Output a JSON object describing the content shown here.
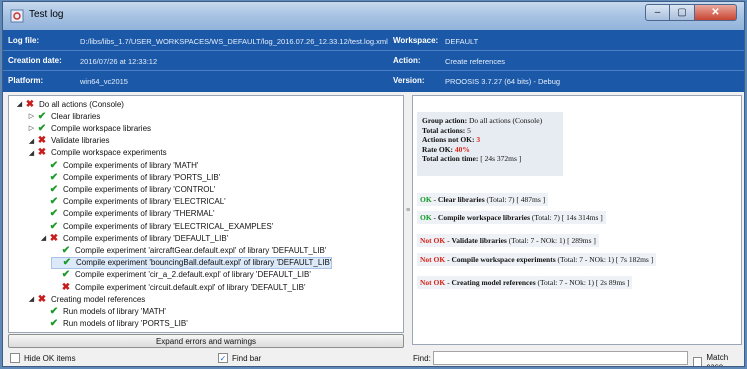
{
  "window": {
    "title": "Test log",
    "minimize": "–",
    "maximize": "▢",
    "close": "✕"
  },
  "header": {
    "log_file_label": "Log file:",
    "log_file_value": "D:/libs/libs_1.7/USER_WORKSPACES/WS_DEFAULT/log_2016.07.26_12.33.12/test.log.xml",
    "workspace_label": "Workspace:",
    "workspace_value": "DEFAULT",
    "creation_label": "Creation date:",
    "creation_value": "2016/07/26 at 12:33:12",
    "action_label": "Action:",
    "action_value": "Create references",
    "platform_label": "Platform:",
    "platform_value": "win64_vc2015",
    "version_label": "Version:",
    "version_value": "PROOSIS 3.7.27 (64 bits) - Debug"
  },
  "tree": [
    {
      "label": "Do all actions (Console)",
      "status": "fail",
      "expander": "expanded",
      "level": 0
    },
    {
      "label": "Clear libraries",
      "status": "ok",
      "expander": "collapsed",
      "level": 1
    },
    {
      "label": "Compile workspace libraries",
      "status": "ok",
      "expander": "collapsed",
      "level": 1
    },
    {
      "label": "Validate libraries",
      "status": "fail",
      "expander": "expanded",
      "level": 1
    },
    {
      "label": "Compile workspace experiments",
      "status": "fail",
      "expander": "expanded",
      "level": 1
    },
    {
      "label": "Compile experiments of library 'MATH'",
      "status": "ok",
      "expander": "none",
      "level": 2
    },
    {
      "label": "Compile experiments of library 'PORTS_LIB'",
      "status": "ok",
      "expander": "none",
      "level": 2
    },
    {
      "label": "Compile experiments of library 'CONTROL'",
      "status": "ok",
      "expander": "none",
      "level": 2
    },
    {
      "label": "Compile experiments of library 'ELECTRICAL'",
      "status": "ok",
      "expander": "none",
      "level": 2
    },
    {
      "label": "Compile experiments of library 'THERMAL'",
      "status": "ok",
      "expander": "none",
      "level": 2
    },
    {
      "label": "Compile experiments of library 'ELECTRICAL_EXAMPLES'",
      "status": "ok",
      "expander": "none",
      "level": 2
    },
    {
      "label": "Compile experiments of library 'DEFAULT_LIB'",
      "status": "fail",
      "expander": "expanded",
      "level": 2
    },
    {
      "label": "Compile experiment 'aircraftGear.default.expl' of library 'DEFAULT_LIB'",
      "status": "ok",
      "expander": "none",
      "level": 3
    },
    {
      "label": "Compile experiment 'bouncingBall.default.expl' of library 'DEFAULT_LIB'",
      "status": "ok",
      "expander": "none",
      "level": 3,
      "selected": true
    },
    {
      "label": "Compile experiment 'cir_a_2.default.expl' of library 'DEFAULT_LIB'",
      "status": "ok",
      "expander": "none",
      "level": 3
    },
    {
      "label": "Compile experiment 'circuit.default.expl' of library 'DEFAULT_LIB'",
      "status": "fail",
      "expander": "none",
      "level": 3
    },
    {
      "label": "Creating model references",
      "status": "fail",
      "expander": "expanded",
      "level": 1
    },
    {
      "label": "Run models of library 'MATH'",
      "status": "ok",
      "expander": "none",
      "level": 2
    },
    {
      "label": "Run models of library 'PORTS_LIB'",
      "status": "ok",
      "expander": "none",
      "level": 2
    }
  ],
  "summary": {
    "group_label": "Group action:",
    "group_value": "Do all actions (Console)",
    "total_label": "Total actions:",
    "total_value": "5",
    "notok_label": "Actions not OK:",
    "notok_value": "3",
    "rate_label": "Rate OK:",
    "rate_value": "40%",
    "time_label": "Total action time:",
    "time_value": "[ 24s 372ms ]"
  },
  "report": [
    {
      "status": "OK",
      "action": "Clear libraries",
      "detail": "(Total: 7) [ 487ms ]",
      "ok": true
    },
    {
      "status": "OK",
      "action": "Compile workspace libraries",
      "detail": "(Total: 7) [ 14s 314ms ]",
      "ok": true
    },
    {
      "status": "Not OK",
      "action": "Validate libraries",
      "detail": "(Total: 7 - NOk: 1) [ 289ms ]",
      "ok": false
    },
    {
      "status": "Not OK",
      "action": "Compile workspace experiments",
      "detail": "(Total: 7 - NOk: 1) [ 7s 182ms ]",
      "ok": false
    },
    {
      "status": "Not OK",
      "action": "Creating model references",
      "detail": "(Total: 7 - NOk: 1) [ 2s 89ms ]",
      "ok": false
    }
  ],
  "controls": {
    "expand_button": "Expand errors and warnings",
    "hide_ok": "Hide OK items",
    "find_bar": "Find bar",
    "find_label": "Find:",
    "find_value": "",
    "find_placeholder": "",
    "match_case": "Match case",
    "check_mark": "✓"
  },
  "icons": {
    "ok": "✔",
    "fail": "✖",
    "expanded": "◢",
    "collapsed": "▷",
    "grip": "≡"
  },
  "colors": {
    "header_bg": "#1b59a8",
    "ok": "#1b9a2a",
    "fail": "#c91c1c"
  }
}
